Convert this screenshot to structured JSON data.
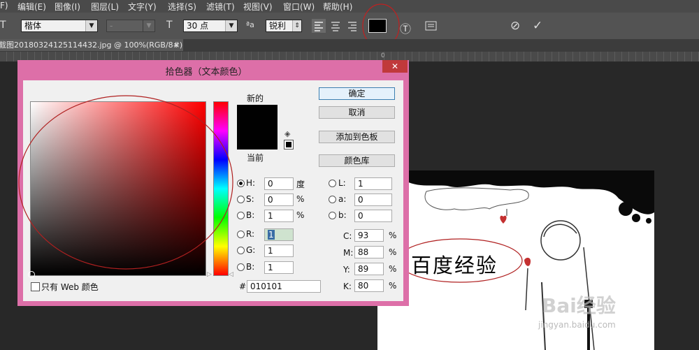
{
  "menu": [
    "F)",
    "编辑(E)",
    "图像(I)",
    "图层(L)",
    "文字(Y)",
    "选择(S)",
    "滤镜(T)",
    "视图(V)",
    "窗口(W)",
    "帮助(H)"
  ],
  "options": {
    "font_family": "楷体",
    "font_style": "-",
    "font_size": "30 点",
    "aa_label": "ªa",
    "antialias": "锐利",
    "color_swatch": "#000000"
  },
  "document_tab": {
    "title": "截图20180324125114432.jpg @ 100%(RGB/8#)",
    "close": "×"
  },
  "ruler_ticks": [
    {
      "label": "0",
      "pos": 545
    }
  ],
  "dialog": {
    "title": "拾色器（文本颜色）",
    "close": "✕",
    "new_label": "新的",
    "current_label": "当前",
    "buttons": {
      "ok": "确定",
      "cancel": "取消",
      "add_swatch": "添加到色板",
      "color_libraries": "颜色库"
    },
    "hsb": [
      {
        "key": "H:",
        "value": "0",
        "unit": "度",
        "selected": true
      },
      {
        "key": "S:",
        "value": "0",
        "unit": "%",
        "selected": false
      },
      {
        "key": "B:",
        "value": "1",
        "unit": "%",
        "selected": false
      }
    ],
    "rgb": [
      {
        "key": "R:",
        "value": "1",
        "selected": false
      },
      {
        "key": "G:",
        "value": "1",
        "selected": false
      },
      {
        "key": "B:",
        "value": "1",
        "selected": false
      }
    ],
    "lab": [
      {
        "key": "L:",
        "value": "1"
      },
      {
        "key": "a:",
        "value": "0"
      },
      {
        "key": "b:",
        "value": "0"
      }
    ],
    "cmyk": [
      {
        "key": "C:",
        "value": "93",
        "unit": "%"
      },
      {
        "key": "M:",
        "value": "88",
        "unit": "%"
      },
      {
        "key": "Y:",
        "value": "89",
        "unit": "%"
      },
      {
        "key": "K:",
        "value": "80",
        "unit": "%"
      }
    ],
    "hex_label": "#",
    "hex": "010101",
    "web_only": "只有 Web 颜色",
    "selected_color": "#010101"
  },
  "canvas": {
    "heading": "百度经验",
    "watermark": "Bai经验",
    "watermark_url": "jingyan.baidu.com"
  }
}
